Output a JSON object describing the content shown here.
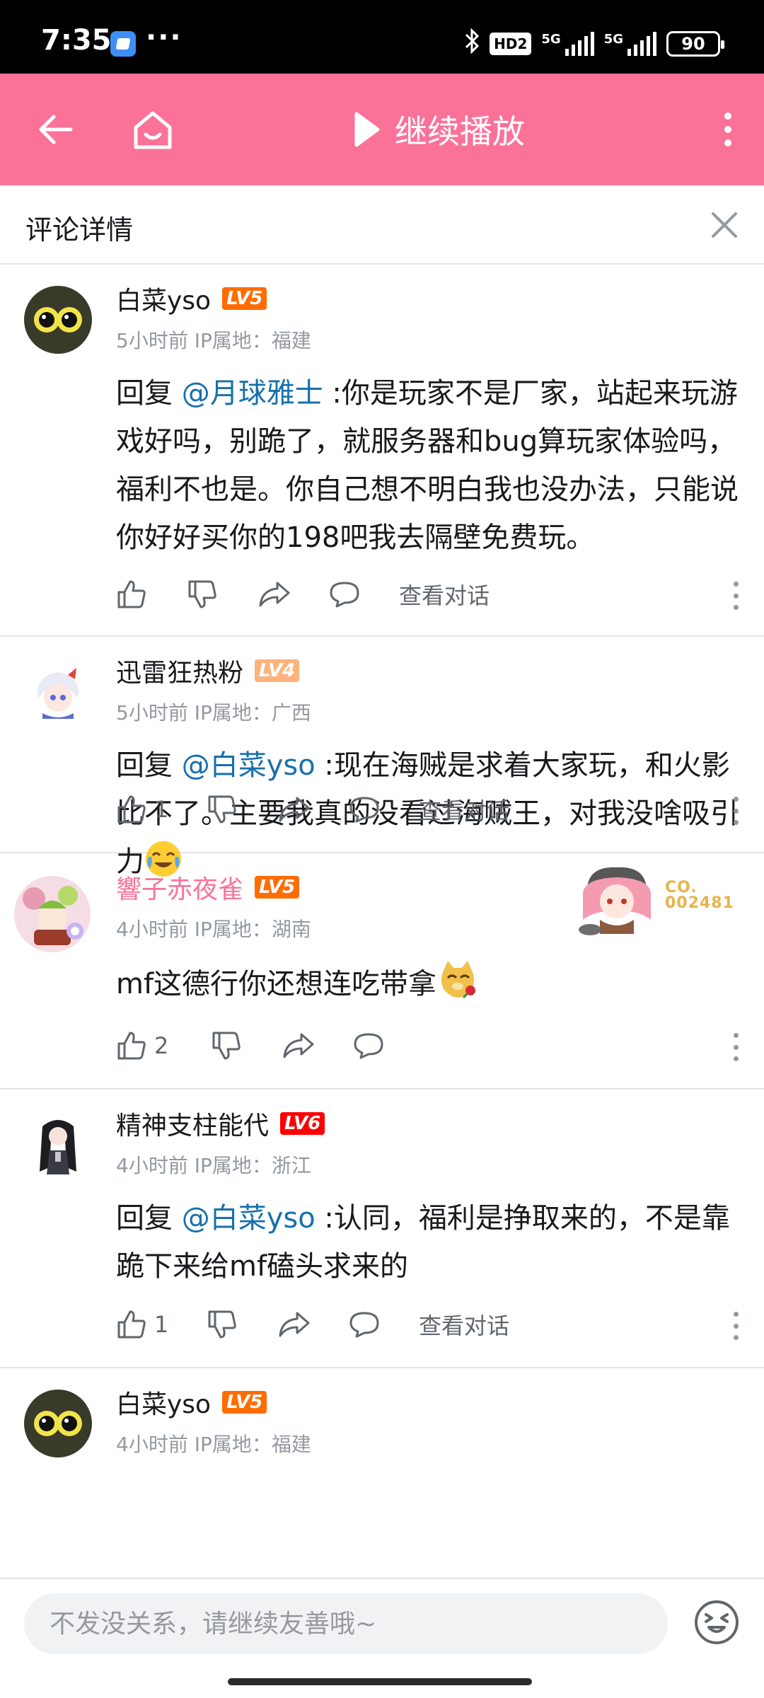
{
  "status_bar": {
    "time": "7:35",
    "dots": "···",
    "hd_label": "HD2",
    "net_label_1": "5G",
    "net_label_2": "5G",
    "battery": "90"
  },
  "top_bar": {
    "continue_label": "继续播放",
    "brand_color": "#fb7299"
  },
  "detail_header": {
    "title": "评论详情"
  },
  "comments": [
    {
      "username": "白菜yso",
      "level": "LV5",
      "time": "5小时前",
      "ip": "IP属地：福建",
      "reply_prefix": "回复 ",
      "mention": "@月球雅士",
      "text": " :你是玩家不是厂家，站起来玩游戏好吗，别跪了，就服务器和bug算玩家体验吗，福利不也是。你自己想不明白我也没办法，只能说你好好买你的198吧我去隔壁免费玩。",
      "likes": "",
      "view_conversation": "查看对话",
      "avatar_icon": "owl-avatar"
    },
    {
      "username": "迅雷狂热粉",
      "level": "LV4",
      "time": "5小时前",
      "ip": "IP属地：广西",
      "reply_prefix": "回复 ",
      "mention": "@白菜yso",
      "text": " :现在海贼是求着大家玩，和火影比不了。主要我真的没看过海贼王，对我没啥吸引力",
      "emoji": "crying-laugh-emoji",
      "likes": "1",
      "view_conversation": "查看对话",
      "avatar_icon": "anime-girl-avatar"
    },
    {
      "username": "響子赤夜雀",
      "level": "LV5",
      "time": "4小时前",
      "ip": "IP属地：湖南",
      "text": "mf这德行你还想连吃带拿",
      "emoji": "doge-rose-emoji",
      "likes": "2",
      "fan_badge_no": "CO.\n002481",
      "avatar_icon": "anime-collage-avatar"
    },
    {
      "username": "精神支柱能代",
      "level": "LV6",
      "time": "4小时前",
      "ip": "IP属地：浙江",
      "reply_prefix": "回复 ",
      "mention": "@白菜yso",
      "text": " :认同，福利是挣取来的，不是靠跪下来给mf磕头求来的",
      "likes": "1",
      "view_conversation": "查看对话",
      "avatar_icon": "dark-hair-girl-avatar"
    },
    {
      "username": "白菜yso",
      "level": "LV5",
      "time": "4小时前",
      "ip": "IP属地：福建",
      "avatar_icon": "owl-avatar"
    }
  ],
  "input_bar": {
    "placeholder": "不发没关系，请继续友善哦~"
  }
}
